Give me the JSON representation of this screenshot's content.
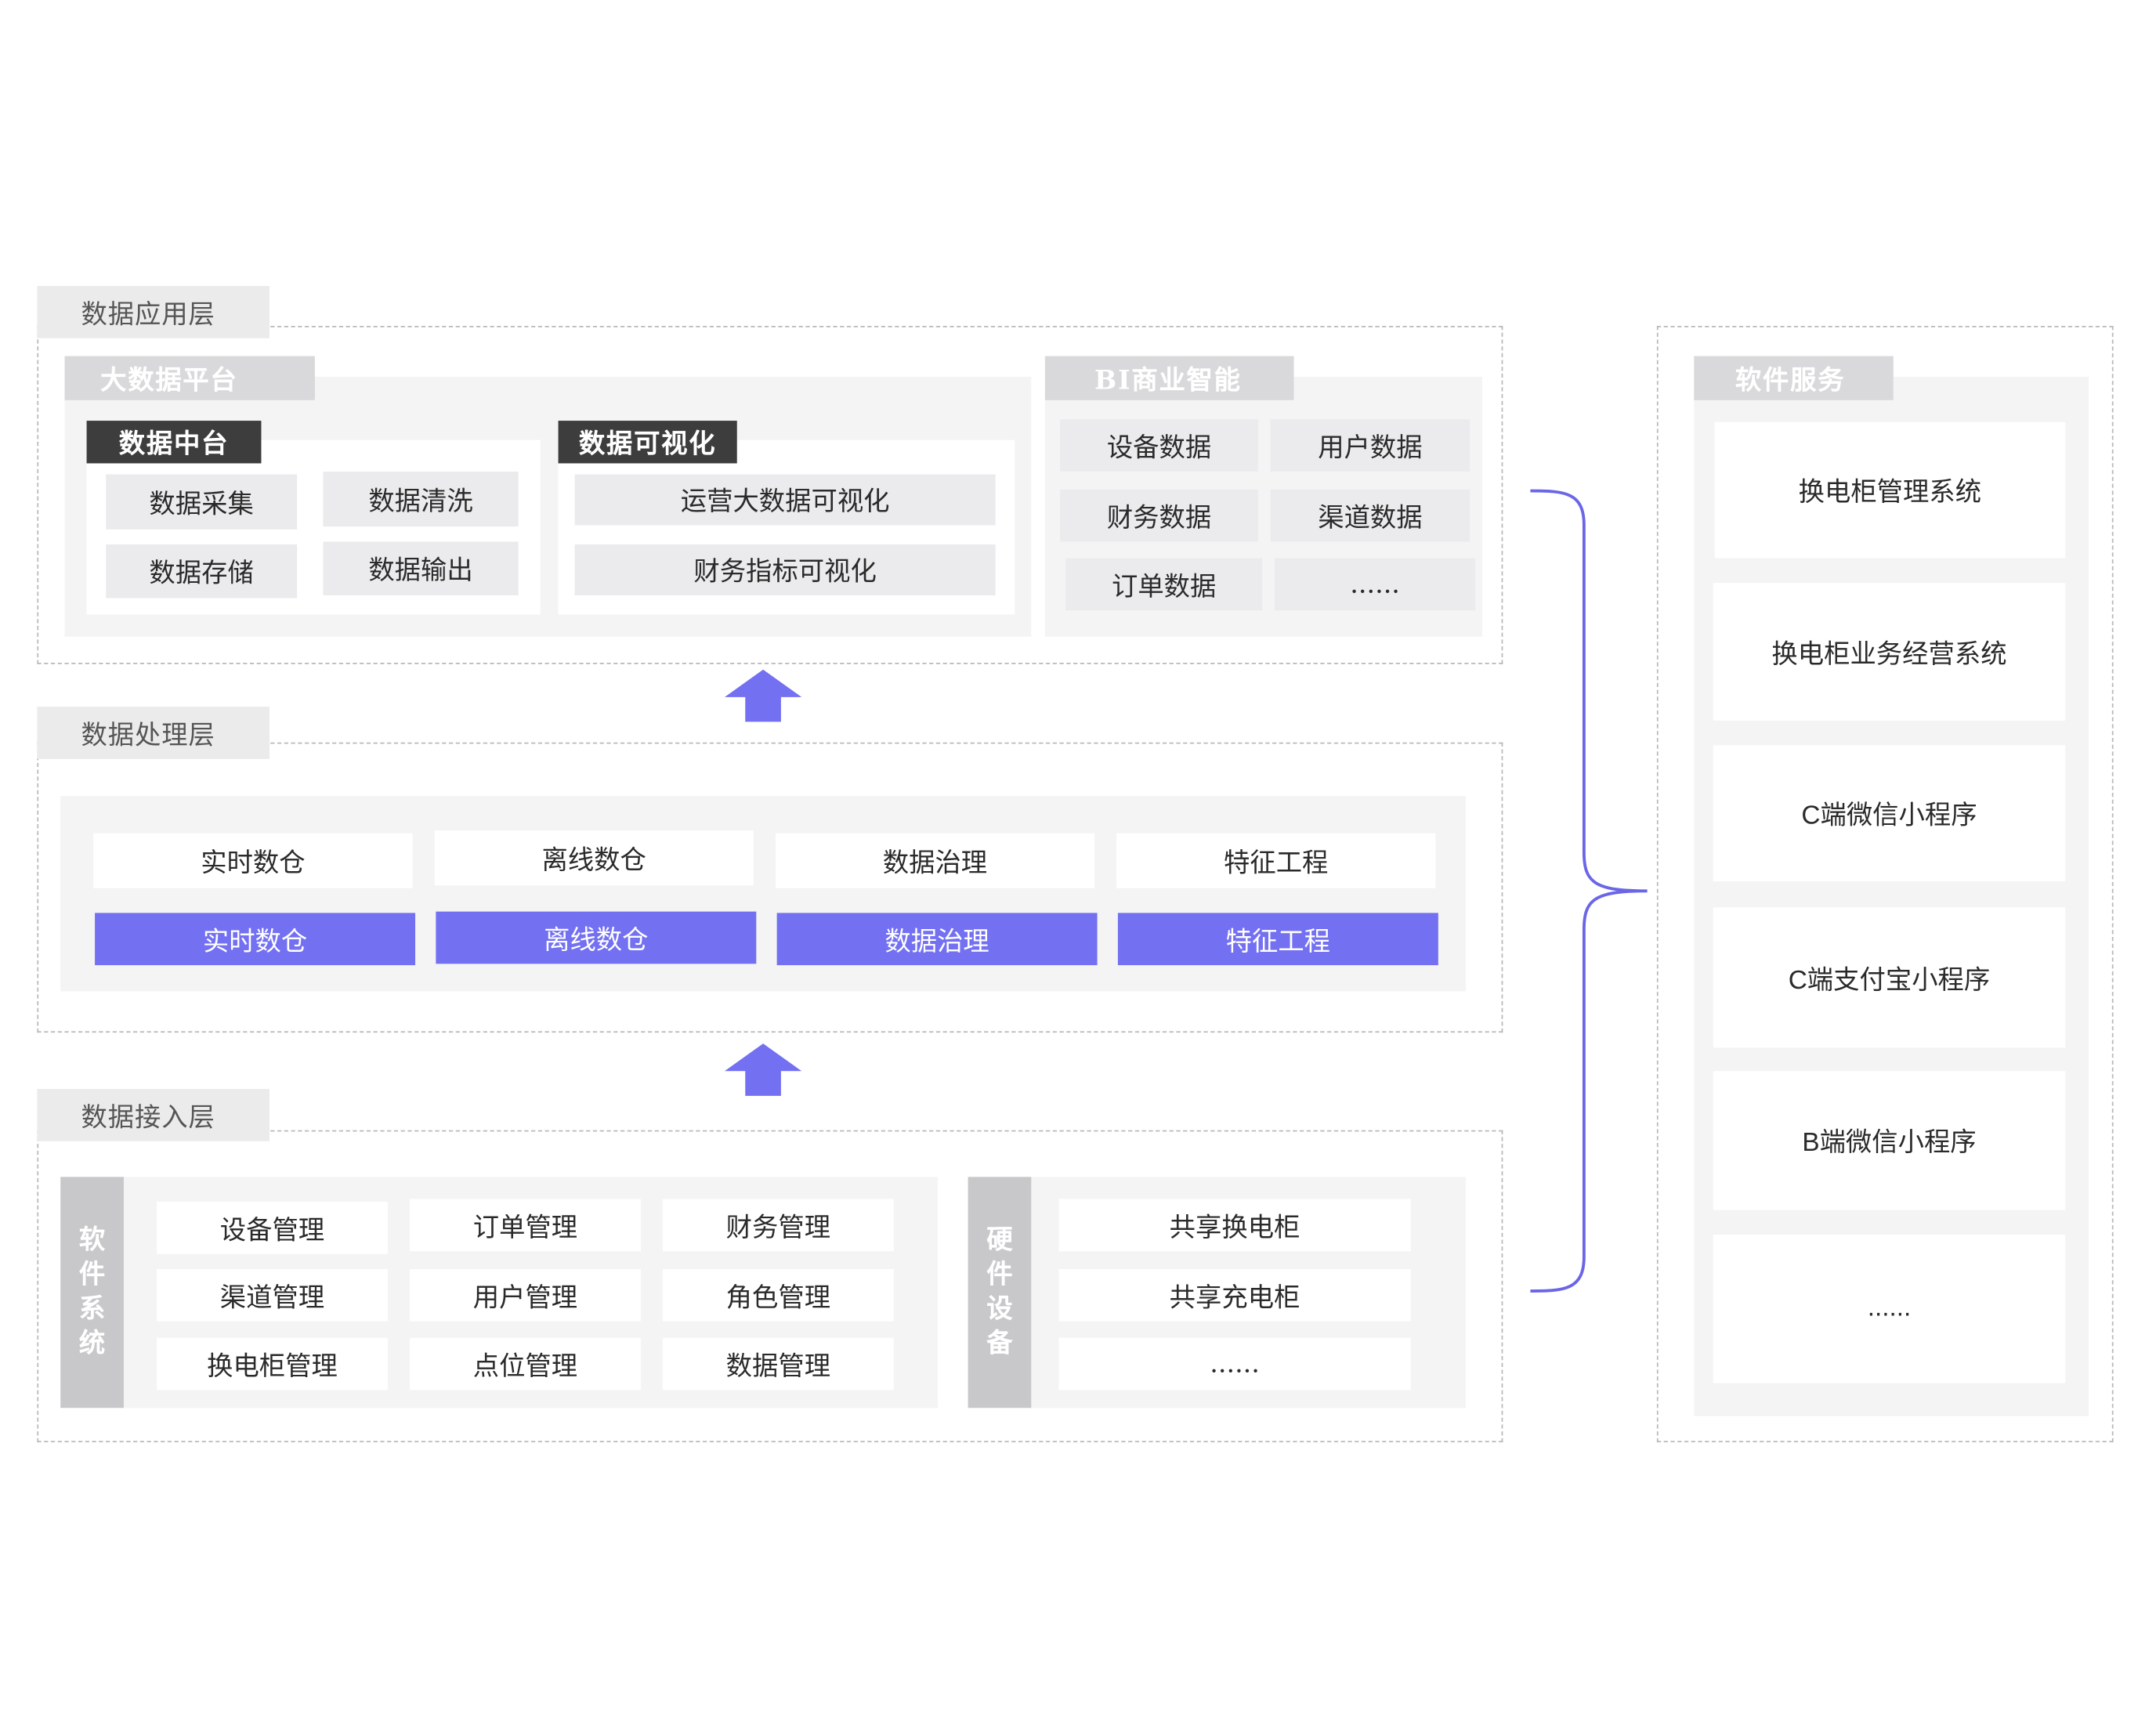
{
  "layers": {
    "application": {
      "title": "数据应用层",
      "big_data_platform": {
        "title": "大数据平台",
        "data_middle": {
          "title": "数据中台",
          "items": [
            "数据采集",
            "数据清洗",
            "数据存储",
            "数据输出"
          ]
        },
        "data_visualization": {
          "title": "数据可视化",
          "items": [
            "运营大数据可视化",
            "财务指标可视化"
          ]
        }
      },
      "bi": {
        "title": "BI商业智能",
        "items": [
          "设备数据",
          "用户数据",
          "财务数据",
          "渠道数据",
          "订单数据",
          "......"
        ]
      }
    },
    "processing": {
      "title": "数据处理层",
      "top_items": [
        "实时数仓",
        "离线数仓",
        "数据治理",
        "特征工程"
      ],
      "bottom_items": [
        "实时数仓",
        "离线数仓",
        "数据治理",
        "特征工程"
      ]
    },
    "access": {
      "title": "数据接入层",
      "software": {
        "title": [
          "软",
          "件",
          "系",
          "统"
        ],
        "items": [
          "设备管理",
          "订单管理",
          "财务管理",
          "渠道管理",
          "用户管理",
          "角色管理",
          "换电柜管理",
          "点位管理",
          "数据管理"
        ]
      },
      "hardware": {
        "title": [
          "硬",
          "件",
          "设",
          "备"
        ],
        "items": [
          "共享换电柜",
          "共享充电柜",
          "......"
        ]
      }
    }
  },
  "software_services": {
    "title": "软件服务",
    "items": [
      "换电柜管理系统",
      "换电柜业务经营系统",
      "C端微信小程序",
      "C端支付宝小程序",
      "B端微信小程序",
      "......"
    ]
  },
  "colors": {
    "accent": "#7370f2",
    "arrow": "#7370f2",
    "brace": "#6b66e6",
    "dark_tag": "#3d3d3d"
  },
  "icons": {
    "flow_arrow": "up-arrow-icon",
    "connector": "curly-brace-icon"
  }
}
